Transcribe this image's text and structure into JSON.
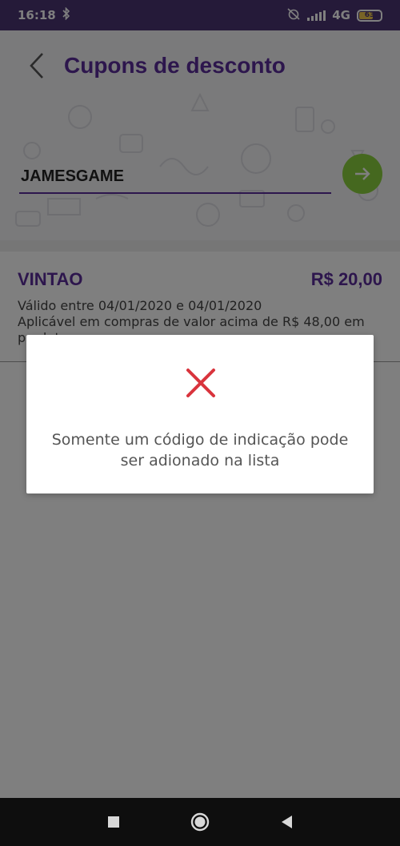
{
  "status_bar": {
    "time": "16:18",
    "network": "4G",
    "battery_level": "63",
    "icons": [
      "bluetooth-icon",
      "alarm-off-icon",
      "signal-icon",
      "battery-icon"
    ]
  },
  "header": {
    "title": "Cupons de desconto",
    "back_icon": "arrow-left-icon"
  },
  "coupon_form": {
    "input_value": "JAMESGAME",
    "submit_icon": "arrow-right-icon"
  },
  "coupons": [
    {
      "code": "VINTAO",
      "value": "R$ 20,00",
      "validity": "Válido entre 04/01/2020 e 04/01/2020",
      "condition": "Aplicável em compras de valor acima de R$ 48,00 em",
      "condition_cont": "produtos"
    }
  ],
  "modal": {
    "icon": "close-x-icon",
    "message": "Somente um código de indicação pode ser adionado na lista"
  },
  "navigation": {
    "icons": [
      "recent-apps-icon",
      "home-icon",
      "back-icon"
    ]
  },
  "colors": {
    "brand_purple": "#5b2d9a",
    "status_bar": "#4a3473",
    "submit_green": "#8bd03e",
    "error_red": "#d9343d"
  }
}
